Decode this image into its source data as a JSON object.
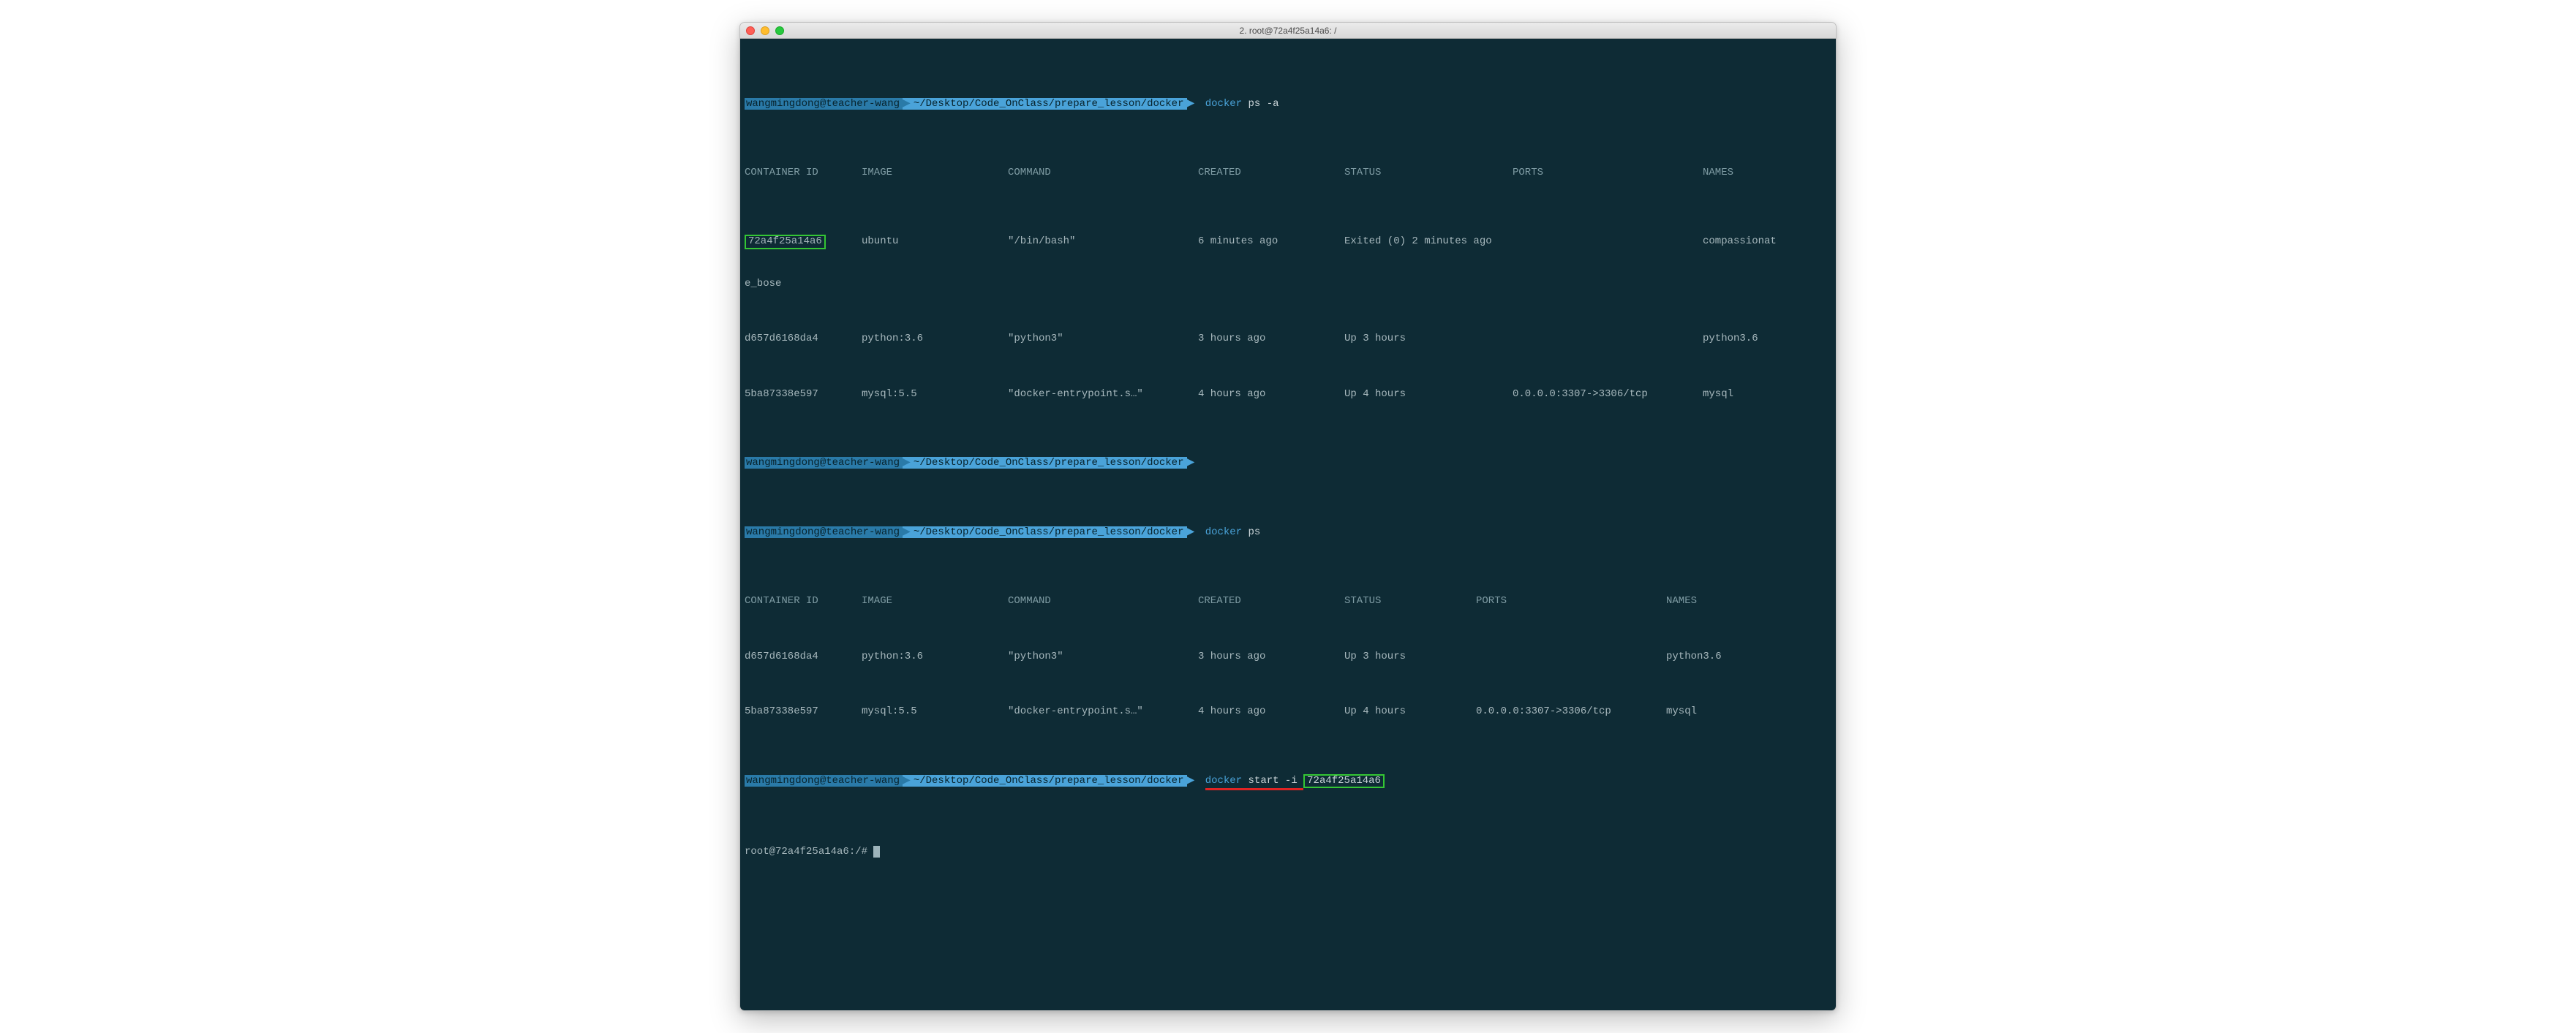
{
  "window": {
    "title": "2. root@72a4f25a14a6: /"
  },
  "prompts": {
    "user": "wangmingdong@teacher-wang",
    "path": "~/Desktop/Code_OnClass/prepare_lesson/docker",
    "arrow": "▶"
  },
  "cmd1": {
    "docker": "docker",
    "args": "ps -a"
  },
  "headers": {
    "cid": "CONTAINER ID",
    "img": "IMAGE",
    "cmd": "COMMAND",
    "cre": "CREATED",
    "sta": "STATUS",
    "por": "PORTS",
    "nam": "NAMES"
  },
  "psa": [
    {
      "cid": "72a4f25a14a6",
      "img": "ubuntu",
      "cmd": "\"/bin/bash\"",
      "cre": "6 minutes ago",
      "sta": "Exited (0) 2 minutes ago",
      "por": "",
      "nam": "compassionat"
    },
    {
      "cid": "d657d6168da4",
      "img": "python:3.6",
      "cmd": "\"python3\"",
      "cre": "3 hours ago",
      "sta": "Up 3 hours",
      "por": "",
      "nam": "python3.6"
    },
    {
      "cid": "5ba87338e597",
      "img": "mysql:5.5",
      "cmd": "\"docker-entrypoint.s…\"",
      "cre": "4 hours ago",
      "sta": "Up 4 hours",
      "por": "0.0.0.0:3307->3306/tcp",
      "nam": "mysql"
    }
  ],
  "wrap_name": "e_bose",
  "cmd2": {
    "docker": "docker",
    "args": "ps"
  },
  "ps": [
    {
      "cid": "d657d6168da4",
      "img": "python:3.6",
      "cmd": "\"python3\"",
      "cre": "3 hours ago",
      "sta": "Up 3 hours",
      "por": "",
      "nam": "python3.6"
    },
    {
      "cid": "5ba87338e597",
      "img": "mysql:5.5",
      "cmd": "\"docker-entrypoint.s…\"",
      "cre": "4 hours ago",
      "sta": "Up 4 hours",
      "por": "0.0.0.0:3307->3306/tcp",
      "nam": "mysql"
    }
  ],
  "cmd3": {
    "docker": "docker",
    "args_pre": "start -i ",
    "cid": "72a4f25a14a6"
  },
  "shell_prompt": "root@72a4f25a14a6:/# ",
  "ps_headers2": {
    "cid": "CONTAINER ID",
    "img": "IMAGE",
    "cmd": "COMMAND",
    "cre": "CREATED",
    "sta": "STATUS",
    "por": "PORTS",
    "nam": "NAMES"
  }
}
